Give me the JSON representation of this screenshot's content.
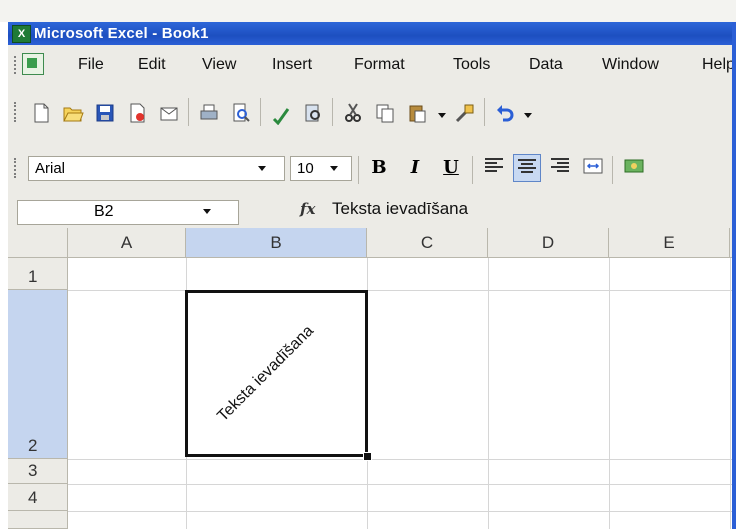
{
  "window": {
    "title": "Microsoft Excel - Book1"
  },
  "menu": [
    "File",
    "Edit",
    "View",
    "Insert",
    "Format",
    "Tools",
    "Data",
    "Window",
    "Help"
  ],
  "format_toolbar": {
    "font": "Arial",
    "size": "10",
    "bold": "B",
    "italic": "I",
    "underline": "U"
  },
  "formula_bar": {
    "name_box": "B2",
    "fx": "fx",
    "content": "Teksta ievadīšana"
  },
  "sheet": {
    "columns": [
      "A",
      "B",
      "C",
      "D",
      "E"
    ],
    "rows": [
      "1",
      "2",
      "3",
      "4"
    ],
    "selected_cell_text": "Teksta ievadīšana"
  },
  "colors": {
    "title_bar": "#2b5fd6",
    "header_selected": "#c5d5ef",
    "toolbar_bg": "#ecebe6"
  }
}
